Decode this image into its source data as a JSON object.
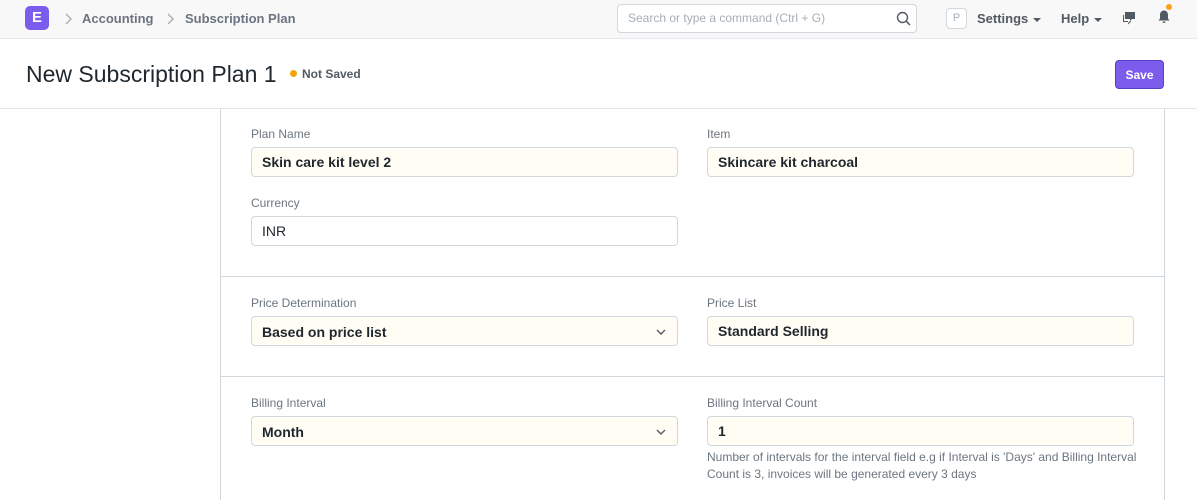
{
  "navbar": {
    "logo_letter": "E",
    "breadcrumbs": [
      "Accounting",
      "Subscription Plan"
    ],
    "search_placeholder": "Search or type a command (Ctrl + G)",
    "avatar_letter": "P",
    "settings_label": "Settings",
    "help_label": "Help"
  },
  "page": {
    "title": "New Subscription Plan 1",
    "status": "Not Saved",
    "save_label": "Save"
  },
  "form": {
    "plan_name": {
      "label": "Plan Name",
      "value": "Skin care kit level 2"
    },
    "item": {
      "label": "Item",
      "value": "Skincare kit charcoal"
    },
    "currency": {
      "label": "Currency",
      "value": "INR"
    },
    "price_determination": {
      "label": "Price Determination",
      "value": "Based on price list"
    },
    "price_list": {
      "label": "Price List",
      "value": "Standard Selling"
    },
    "billing_interval": {
      "label": "Billing Interval",
      "value": "Month"
    },
    "billing_interval_count": {
      "label": "Billing Interval Count",
      "value": "1",
      "help": "Number of intervals for the interval field e.g if Interval is 'Days' and Billing Interval Count is 3, invoices will be generated every 3 days"
    }
  },
  "colors": {
    "accent": "#7c5ced",
    "status_dot": "#f2a60c",
    "notification_dot": "#ff9f1a"
  }
}
